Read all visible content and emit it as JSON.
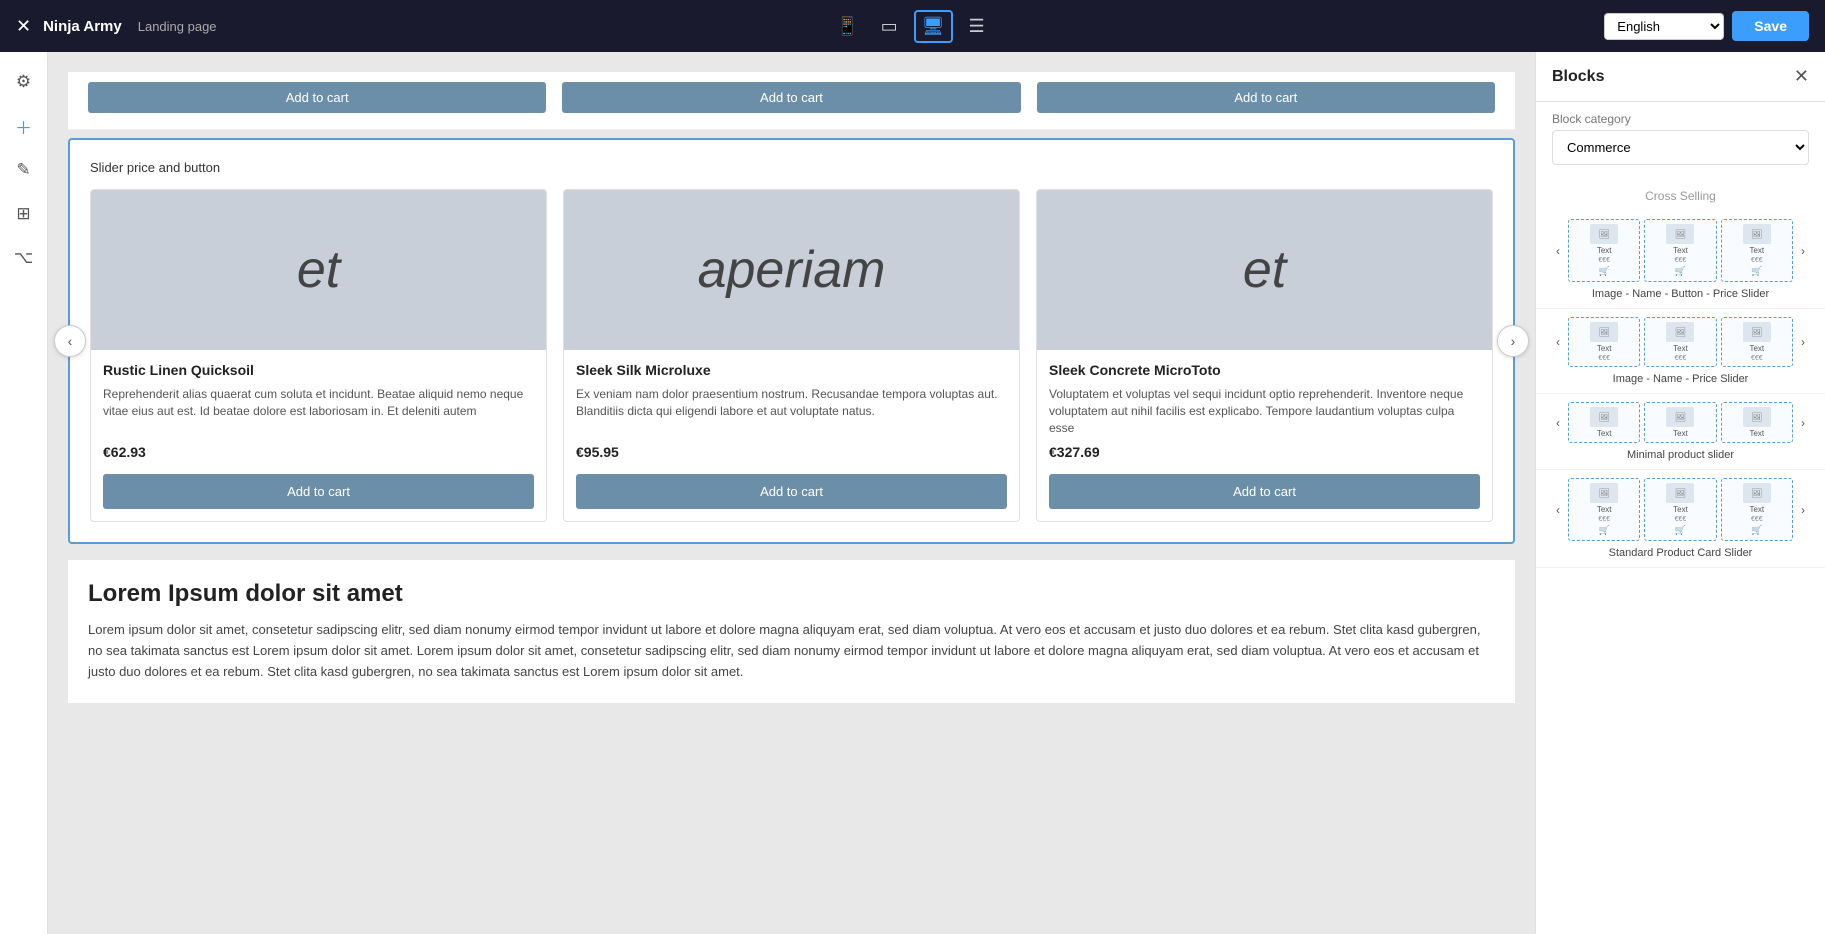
{
  "topbar": {
    "close_icon": "✕",
    "brand": "Ninja Army",
    "subtitle": "Landing page",
    "device_icons": [
      "📱",
      "⬜",
      "🖥",
      "☰"
    ],
    "active_device": 2,
    "lang": "English",
    "save_label": "Save"
  },
  "left_sidebar": {
    "icons": [
      "⚙",
      "+",
      "✎",
      "⊞",
      "⌥"
    ]
  },
  "canvas": {
    "top_cards_add_to_cart": [
      "Add to cart",
      "Add to cart",
      "Add to cart"
    ],
    "slider": {
      "label": "Slider price and button",
      "nav_left": "‹",
      "nav_right": "›",
      "cards": [
        {
          "image_text": "et",
          "name": "Rustic Linen Quicksoil",
          "desc": "Reprehenderit alias quaerat cum soluta et incidunt. Beatae aliquid nemo neque vitae eius aut est. Id beatae dolore est laboriosam in. Et deleniti autem",
          "price": "€62.93",
          "btn_label": "Add to cart"
        },
        {
          "image_text": "aperiam",
          "name": "Sleek Silk Microluxe",
          "desc": "Ex veniam nam dolor praesentium nostrum. Recusandae tempora voluptas aut. Blanditiis dicta qui eligendi labore et aut voluptate natus.",
          "price": "€95.95",
          "btn_label": "Add to cart"
        },
        {
          "image_text": "et",
          "name": "Sleek Concrete MicroToto",
          "desc": "Voluptatem et voluptas vel sequi incidunt optio reprehenderit. Inventore neque voluptatem aut nihil facilis est explicabo. Tempore laudantium voluptas culpa esse",
          "price": "€327.69",
          "btn_label": "Add to cart"
        }
      ]
    },
    "text_section": {
      "heading": "Lorem Ipsum dolor sit amet",
      "body": "Lorem ipsum dolor sit amet, consetetur sadipscing elitr, sed diam nonumy eirmod tempor invidunt ut labore et dolore magna aliquyam erat, sed diam voluptua. At vero eos et accusam et justo duo dolores et ea rebum. Stet clita kasd gubergren, no sea takimata sanctus est Lorem ipsum dolor sit amet. Lorem ipsum dolor sit amet, consetetur sadipscing elitr, sed diam nonumy eirmod tempor invidunt ut labore et dolore magna aliquyam erat, sed diam voluptua. At vero eos et accusam et justo duo dolores et ea rebum. Stet clita kasd gubergren, no sea takimata sanctus est Lorem ipsum dolor sit amet."
    }
  },
  "right_panel": {
    "title": "Blocks",
    "close_icon": "✕",
    "category_label": "Block category",
    "category_value": "Commerce",
    "cross_selling_label": "Cross Selling",
    "blocks": [
      {
        "name": "Image - Name - Button - Price Slider",
        "cards": [
          {
            "label": "Text",
            "price": "€€€",
            "has_cart": true
          },
          {
            "label": "Text",
            "price": "€€€",
            "has_cart": true
          },
          {
            "label": "Text",
            "price": "€€€",
            "has_cart": true
          }
        ]
      },
      {
        "name": "Image - Name - Price Slider",
        "cards": [
          {
            "label": "Text",
            "price": "€€€",
            "has_cart": false
          },
          {
            "label": "Text",
            "price": "€€€",
            "has_cart": false
          },
          {
            "label": "Text",
            "price": "€€€",
            "has_cart": false
          }
        ]
      },
      {
        "name": "Minimal product slider",
        "cards": [
          {
            "label": "Text",
            "price": "",
            "has_cart": false
          },
          {
            "label": "Text",
            "price": "",
            "has_cart": false
          },
          {
            "label": "Text",
            "price": "",
            "has_cart": false
          }
        ]
      },
      {
        "name": "Standard Product Card Slider",
        "cards": [
          {
            "label": "Text",
            "price": "€€€",
            "has_cart": true
          },
          {
            "label": "Text",
            "price": "€€€",
            "has_cart": true
          },
          {
            "label": "Text",
            "price": "€€€",
            "has_cart": true
          }
        ]
      }
    ]
  }
}
